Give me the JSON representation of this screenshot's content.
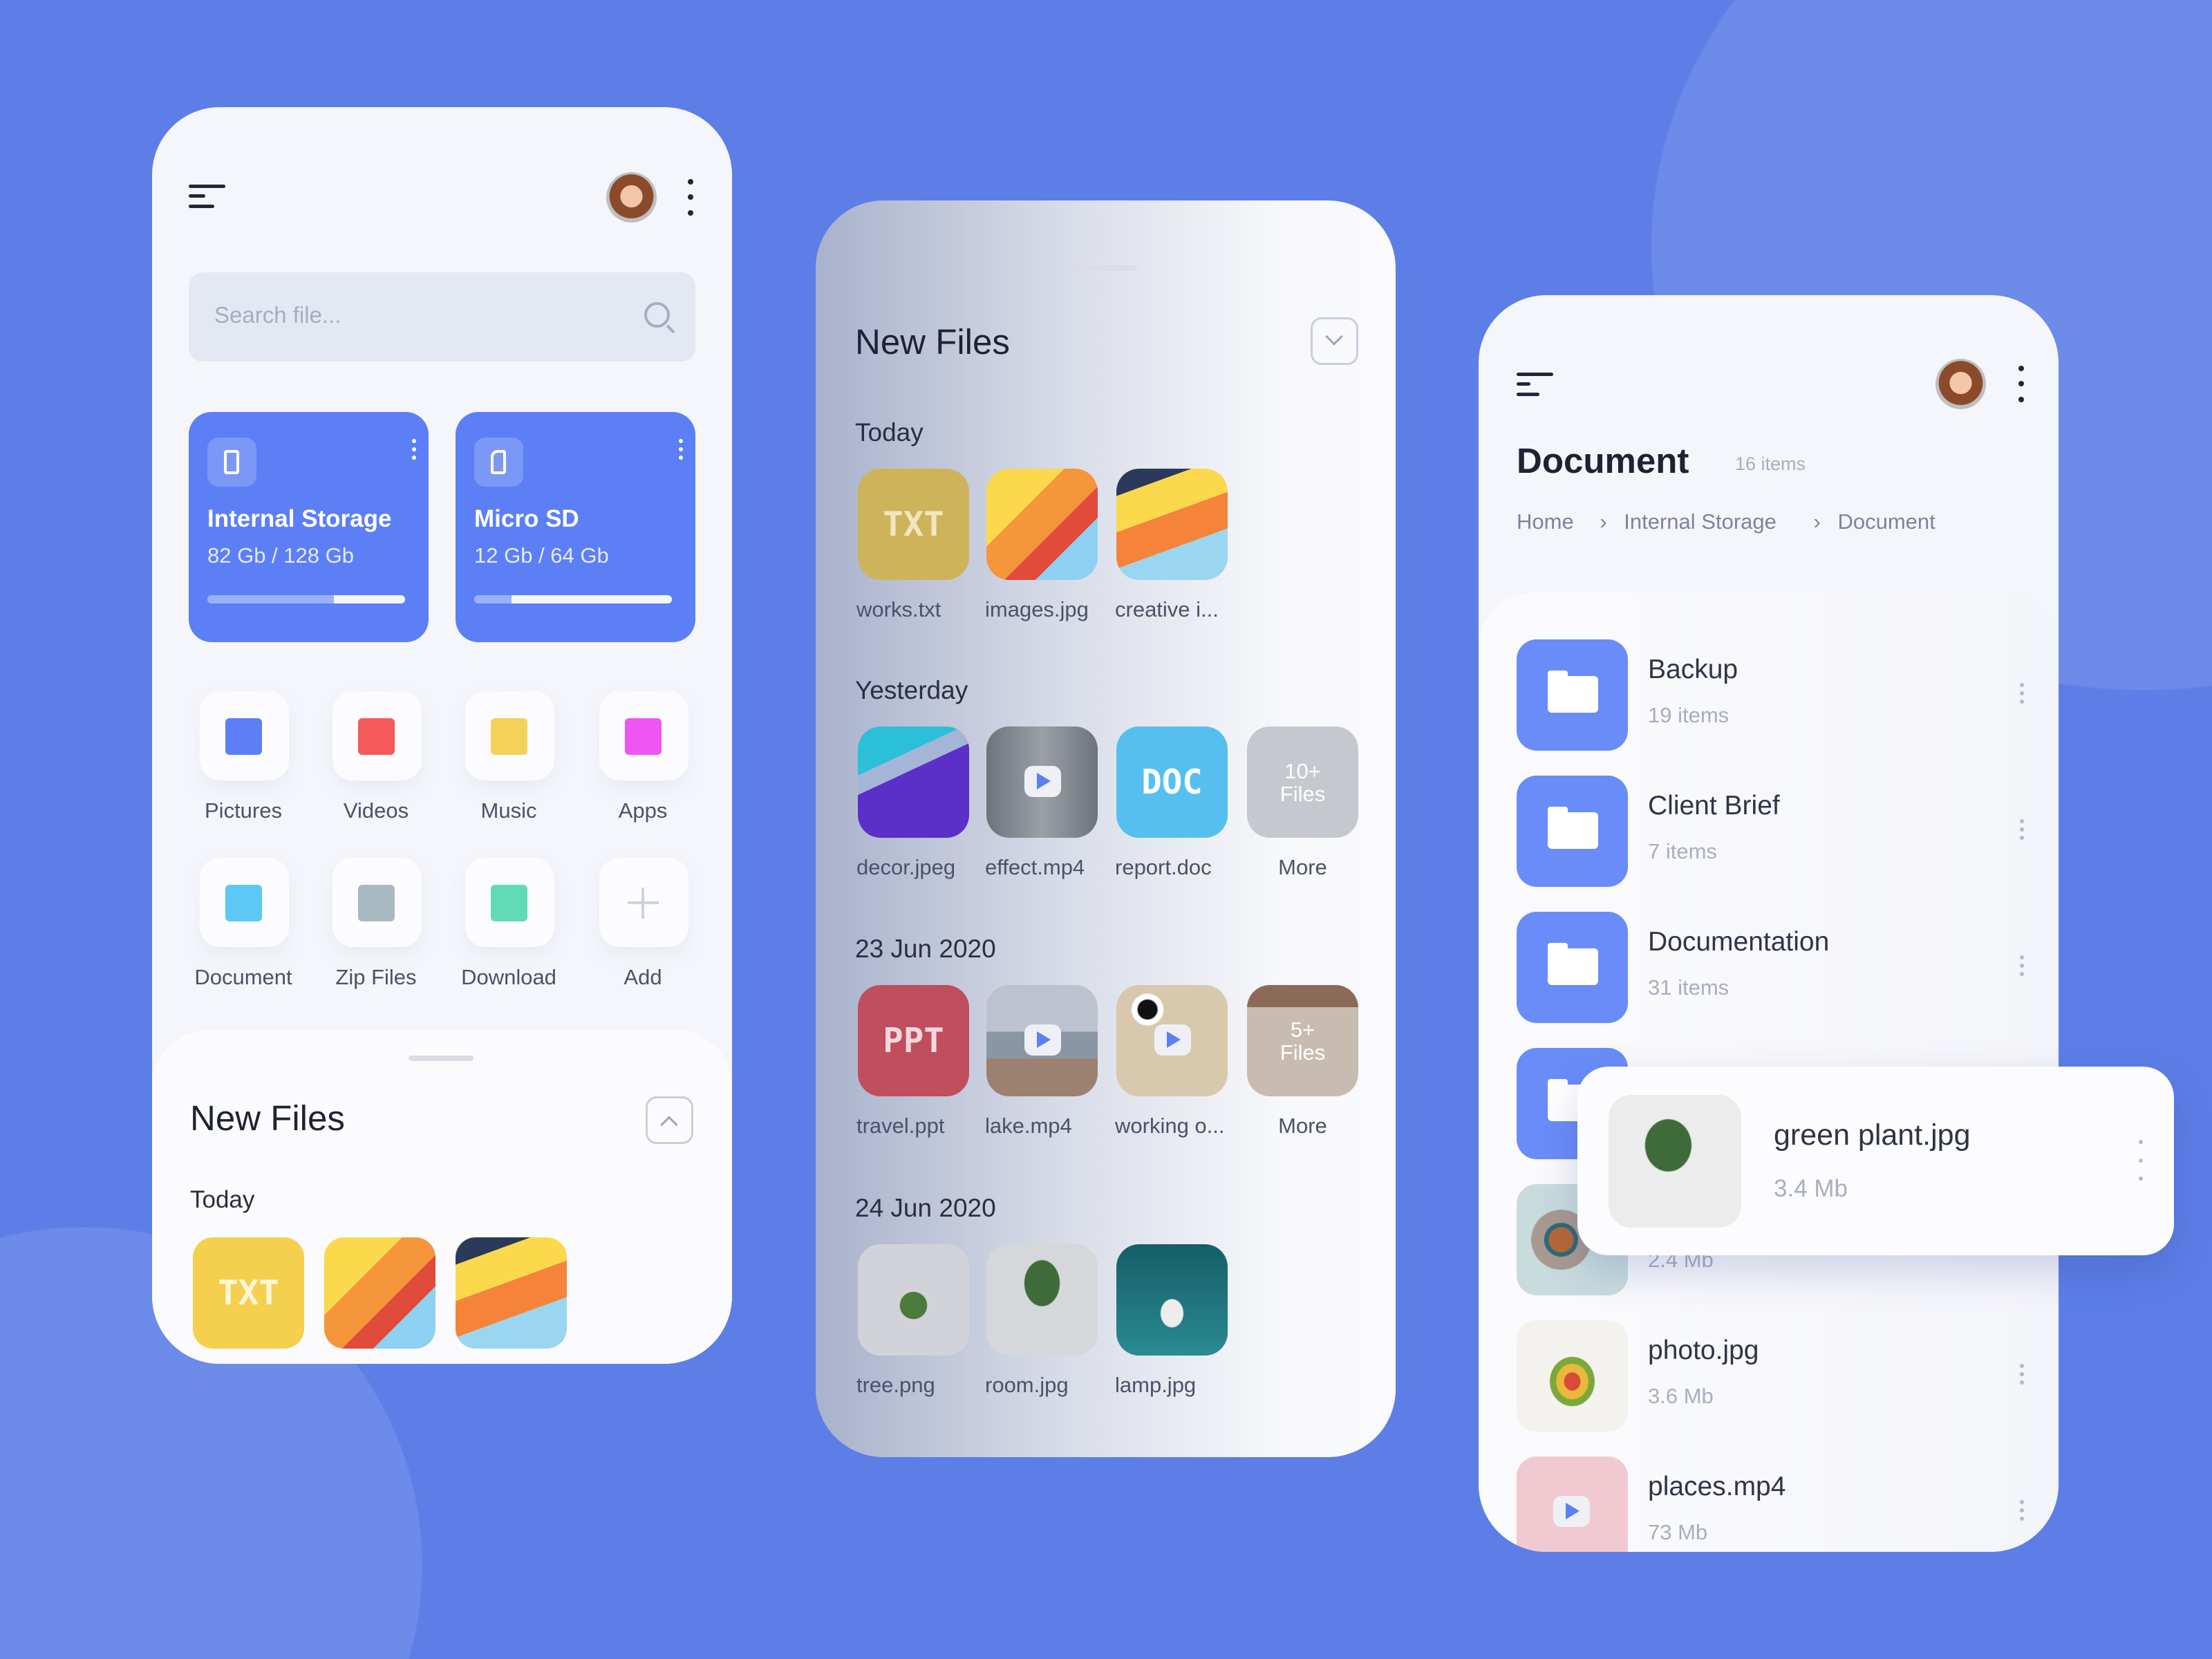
{
  "colors": {
    "background": "#5C7EE6",
    "accent": "#5C7FF6"
  },
  "left": {
    "search": {
      "placeholder": "Search file..."
    },
    "storage": [
      {
        "title": "Internal Storage",
        "usage": "82 Gb / 128 Gb",
        "used_fraction": 0.64,
        "icon": "phone-icon"
      },
      {
        "title": "Micro SD",
        "usage": "12 Gb / 64 Gb",
        "used_fraction": 0.19,
        "icon": "sd-card-icon"
      }
    ],
    "categories": [
      {
        "label": "Pictures",
        "icon": "image-icon",
        "color": "#5C7FF6"
      },
      {
        "label": "Videos",
        "icon": "video-icon",
        "color": "#F55A5A"
      },
      {
        "label": "Music",
        "icon": "music-icon",
        "color": "#F6D15A"
      },
      {
        "label": "Apps",
        "icon": "apps-icon",
        "color": "#EE55F2"
      },
      {
        "label": "Document",
        "icon": "document-icon",
        "color": "#5CC8F6"
      },
      {
        "label": "Zip Files",
        "icon": "zip-icon",
        "color": "#A9B9C2"
      },
      {
        "label": "Download",
        "icon": "download-icon",
        "color": "#60DBB6"
      },
      {
        "label": "Add",
        "icon": "plus-icon",
        "color": "#CDD2E0"
      }
    ],
    "sheet": {
      "title": "New Files",
      "section": "Today",
      "files": [
        {
          "kind": "t-txt",
          "badge": "TXT"
        },
        {
          "kind": "t-paper1"
        },
        {
          "kind": "t-paper2"
        }
      ]
    }
  },
  "middle": {
    "title": "New Files",
    "sections": [
      {
        "label": "Today",
        "files": [
          {
            "name": "works.txt",
            "kind": "t-txtm",
            "badge": "TXT"
          },
          {
            "name": "images.jpg",
            "kind": "t-paper1"
          },
          {
            "name": "creative i...",
            "kind": "t-paper2"
          }
        ]
      },
      {
        "label": "Yesterday",
        "files": [
          {
            "name": "decor.jpeg",
            "kind": "t-decor"
          },
          {
            "name": "effect.mp4",
            "kind": "t-effect",
            "video": true
          },
          {
            "name": "report.doc",
            "kind": "t-doc",
            "badge": "DOC"
          },
          {
            "name": "More",
            "kind": "t-more1",
            "badge": "10+ Files",
            "more": true
          }
        ]
      },
      {
        "label": "23 Jun 2020",
        "files": [
          {
            "name": "travel.ppt",
            "kind": "t-ppt",
            "badge": "PPT"
          },
          {
            "name": "lake.mp4",
            "kind": "t-lake",
            "video": true
          },
          {
            "name": "working o...",
            "kind": "t-working",
            "video": true
          },
          {
            "name": "More",
            "kind": "t-more2",
            "badge": "5+ Files",
            "more": true
          }
        ]
      },
      {
        "label": "24 Jun 2020",
        "files": [
          {
            "name": "tree.png",
            "kind": "t-tree"
          },
          {
            "name": "room.jpg",
            "kind": "t-room"
          },
          {
            "name": "lamp.jpg",
            "kind": "t-lamp"
          }
        ]
      }
    ]
  },
  "right": {
    "title": "Document",
    "count": "16 items",
    "breadcrumb": [
      "Home",
      "Internal Storage",
      "Document"
    ],
    "items": [
      {
        "type": "folder",
        "name": "Backup",
        "sub": "19 items"
      },
      {
        "type": "folder",
        "name": "Client Brief",
        "sub": "7 items"
      },
      {
        "type": "folder",
        "name": "Documentation",
        "sub": "31 items"
      },
      {
        "type": "folder"
      },
      {
        "type": "image",
        "kind": "t-coffee",
        "sub": "2.4 Mb"
      },
      {
        "type": "image",
        "kind": "t-photo",
        "name": "photo.jpg",
        "sub": "3.6 Mb"
      },
      {
        "type": "video",
        "kind": "t-places",
        "name": "places.mp4",
        "sub": "73 Mb"
      }
    ],
    "popup": {
      "name": "green plant.jpg",
      "size": "3.4 Mb",
      "kind": "t-plant"
    }
  }
}
